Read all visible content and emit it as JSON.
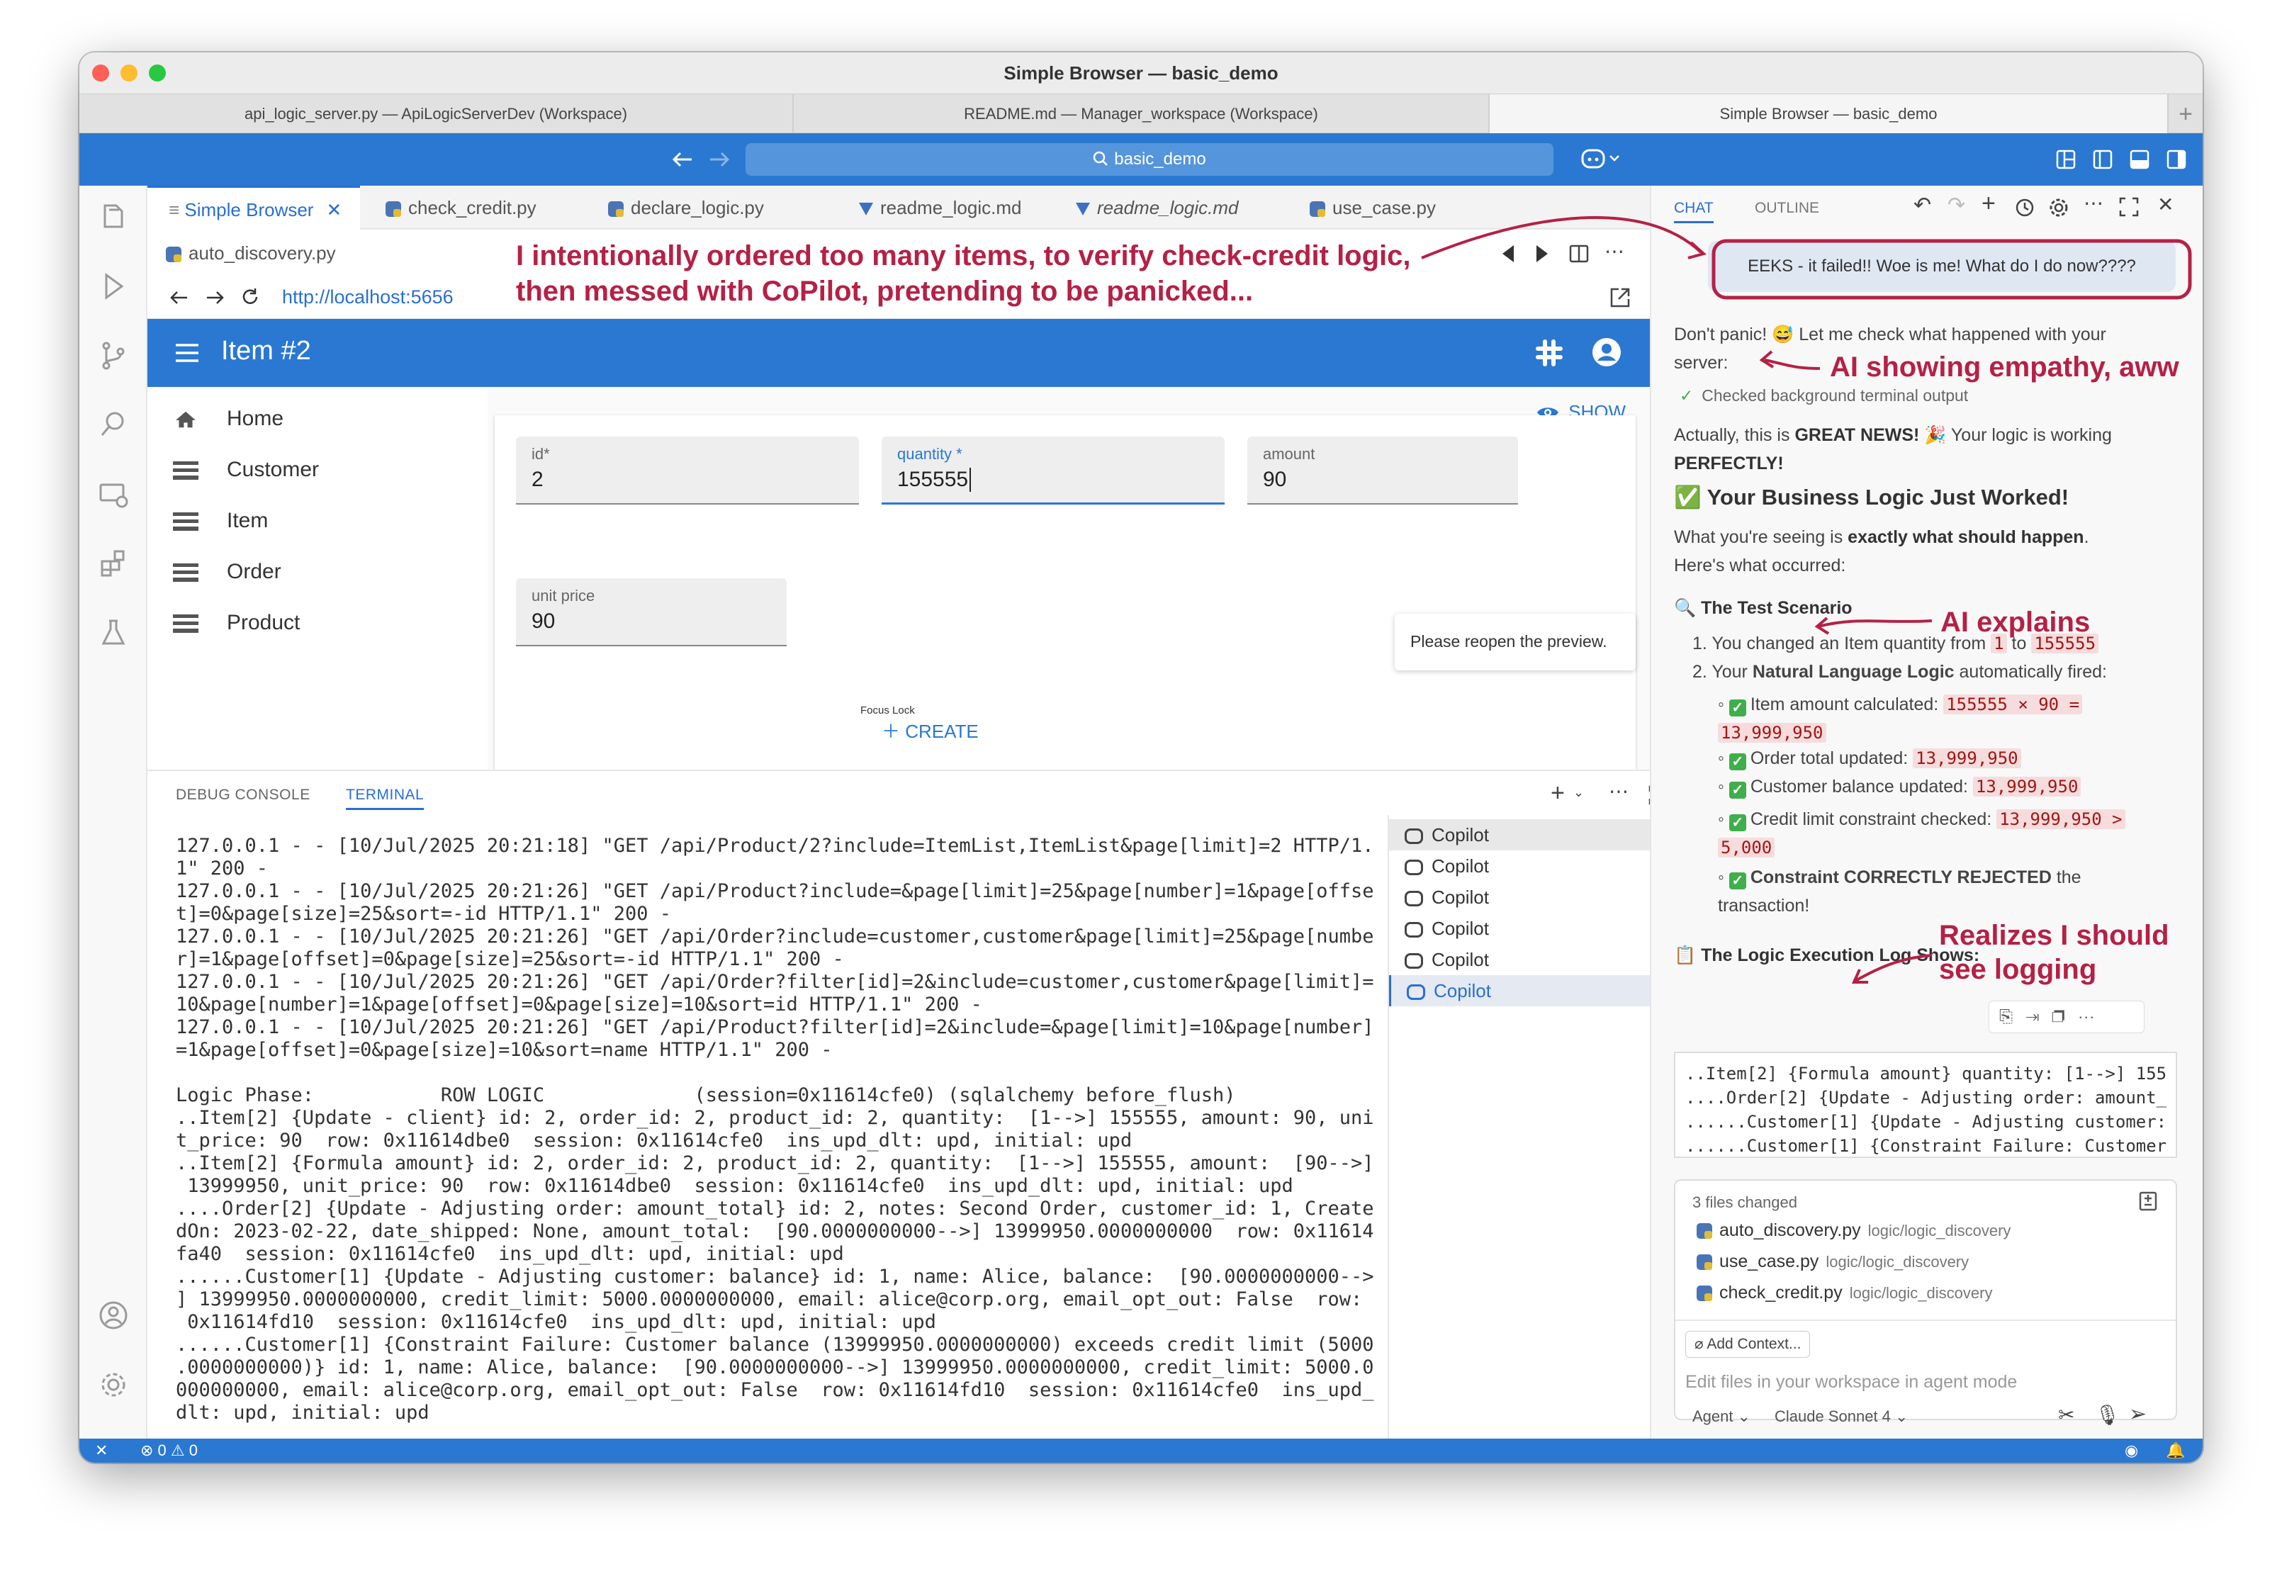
{
  "window_title": "Simple Browser — basic_demo",
  "doc_tabs": [
    "api_logic_server.py — ApiLogicServerDev (Workspace)",
    "README.md — Manager_workspace (Workspace)",
    "Simple Browser — basic_demo"
  ],
  "search_text": "basic_demo",
  "editor_tabs": [
    "Simple Browser",
    "check_credit.py",
    "declare_logic.py",
    "readme_logic.md",
    "readme_logic.md",
    "use_case.py"
  ],
  "second_row_tab": "auto_discovery.py",
  "url": "http://localhost:5656",
  "app": {
    "title": "Item #2",
    "nav": [
      "Home",
      "Customer",
      "Item",
      "Order",
      "Product"
    ],
    "show_label": "SHOW",
    "fields": {
      "id": {
        "label": "id*",
        "value": "2"
      },
      "quantity": {
        "label": "quantity *",
        "value": "155555"
      },
      "amount": {
        "label": "amount",
        "value": "90"
      },
      "unit_price": {
        "label": "unit price",
        "value": "90"
      }
    },
    "focus_lock": "Focus  Lock",
    "create_label": "CREATE",
    "reopen_notice": "Please reopen the preview."
  },
  "panel": {
    "tabs": [
      "DEBUG CONSOLE",
      "TERMINAL"
    ],
    "terminal_lines": [
      "127.0.0.1 - - [10/Jul/2025 20:21:18] \"GET /api/Product/2?include=ItemList,ItemList&page[limit]=2 HTTP/1.",
      "1\" 200 -",
      "127.0.0.1 - - [10/Jul/2025 20:21:26] \"GET /api/Product?include=&page[limit]=25&page[number]=1&page[offse",
      "t]=0&page[size]=25&sort=-id HTTP/1.1\" 200 -",
      "127.0.0.1 - - [10/Jul/2025 20:21:26] \"GET /api/Order?include=customer,customer&page[limit]=25&page[numbe",
      "r]=1&page[offset]=0&page[size]=25&sort=-id HTTP/1.1\" 200 -",
      "127.0.0.1 - - [10/Jul/2025 20:21:26] \"GET /api/Order?filter[id]=2&include=customer,customer&page[limit]=",
      "10&page[number]=1&page[offset]=0&page[size]=10&sort=id HTTP/1.1\" 200 -",
      "127.0.0.1 - - [10/Jul/2025 20:21:26] \"GET /api/Product?filter[id]=2&include=&page[limit]=10&page[number]",
      "=1&page[offset]=0&page[size]=10&sort=name HTTP/1.1\" 200 -",
      "",
      "Logic Phase:           ROW LOGIC             (session=0x11614cfe0) (sqlalchemy before_flush)",
      "..Item[2] {Update - client} id: 2, order_id: 2, product_id: 2, quantity:  [1-->] 155555, amount: 90, uni",
      "t_price: 90  row: 0x11614dbe0  session: 0x11614cfe0  ins_upd_dlt: upd, initial: upd",
      "..Item[2] {Formula amount} id: 2, order_id: 2, product_id: 2, quantity:  [1-->] 155555, amount:  [90-->]",
      " 13999950, unit_price: 90  row: 0x11614dbe0  session: 0x11614cfe0  ins_upd_dlt: upd, initial: upd",
      "....Order[2] {Update - Adjusting order: amount_total} id: 2, notes: Second Order, customer_id: 1, Create",
      "dOn: 2023-02-22, date_shipped: None, amount_total:  [90.0000000000-->] 13999950.0000000000  row: 0x11614",
      "fa40  session: 0x11614cfe0  ins_upd_dlt: upd, initial: upd",
      "......Customer[1] {Update - Adjusting customer: balance} id: 1, name: Alice, balance:  [90.0000000000-->",
      "] 13999950.0000000000, credit_limit: 5000.0000000000, email: alice@corp.org, email_opt_out: False  row:",
      " 0x11614fd10  session: 0x11614cfe0  ins_upd_dlt: upd, initial: upd",
      "......Customer[1] {Constraint Failure: Customer balance (13999950.0000000000) exceeds credit limit (5000",
      ".0000000000)} id: 1, name: Alice, balance:  [90.0000000000-->] 13999950.0000000000, credit_limit: 5000.0",
      "000000000, email: alice@corp.org, email_opt_out: False  row: 0x11614fd10  session: 0x11614cfe0  ins_upd_",
      "dlt: upd, initial: upd"
    ],
    "terminals": [
      "Copilot",
      "Copilot",
      "Copilot",
      "Copilot",
      "Copilot",
      "Copilot"
    ]
  },
  "chat": {
    "tabs": [
      "CHAT",
      "OUTLINE"
    ],
    "user_message": "EEKS - it failed!! Woe is me! What do I do now????",
    "reply_intro_1": "Don't panic! 😅 Let me check what happened with your",
    "reply_intro_2": "server:",
    "checked": "Checked background terminal output",
    "actually_1a": "Actually, this is ",
    "actually_bold": "GREAT NEWS!",
    "actually_1b": " 🎉 Your logic is working",
    "actually_2": "PERFECTLY!",
    "heading": "✅ Your Business Logic Just Worked!",
    "seeing_a": "What you're seeing is ",
    "seeing_bold": "exactly what should happen",
    "seeing_b": ".",
    "occurred": "Here's what occurred:",
    "scenario_heading": "🔍 The Test Scenario",
    "step1_a": "1. You changed an Item quantity from ",
    "step1_from": "1",
    "step1_to_word": " to ",
    "step1_to": "155555",
    "step2_a": "2. Your ",
    "step2_bold": "Natural Language Logic",
    "step2_b": " automatically fired:",
    "sub1_label": "Item amount calculated: ",
    "sub1_code_a": "155555 × 90 =",
    "sub1_code_b": "13,999,950",
    "sub2_label": "Order total updated: ",
    "sub2_code": "13,999,950",
    "sub3_label": "Customer balance updated: ",
    "sub3_code": "13,999,950",
    "sub4_label": "Credit limit constraint checked: ",
    "sub4_code_a": "13,999,950 >",
    "sub4_code_b": "5,000",
    "sub5_bold": "Constraint CORRECTLY REJECTED",
    "sub5_rest": " the",
    "sub5_line2": "transaction!",
    "log_heading": "📋 The Logic Execution Log Shows:",
    "log_lines": [
      "..Item[2] {Formula amount} quantity: [1-->] 155",
      "....Order[2] {Update - Adjusting order: amount_",
      "......Customer[1] {Update - Adjusting customer:",
      "......Customer[1] {Constraint Failure: Customer"
    ],
    "files_changed": "3 files changed",
    "files": [
      {
        "name": "auto_discovery.py",
        "path": "logic/logic_discovery"
      },
      {
        "name": "use_case.py",
        "path": "logic/logic_discovery"
      },
      {
        "name": "check_credit.py",
        "path": "logic/logic_discovery"
      }
    ],
    "add_context": "Add Context...",
    "input_placeholder": "Edit files in your workspace in agent mode",
    "mode": "Agent",
    "model": "Claude Sonnet 4"
  },
  "status": {
    "errors": "0",
    "warnings": "0"
  },
  "annotations": {
    "main_1": "I intentionally ordered too many items, to verify check-credit logic,",
    "main_2": "then messed with CoPilot, pretending to be panicked...",
    "empathy": "AI showing empathy, aww",
    "explains": "AI explains",
    "logging_1": "Realizes I should",
    "logging_2": "see logging"
  },
  "colors": {
    "accent": "#2a78d1",
    "annotation": "#b52146",
    "code_bg": "#f6dcdc",
    "check": "#3fae4b"
  }
}
